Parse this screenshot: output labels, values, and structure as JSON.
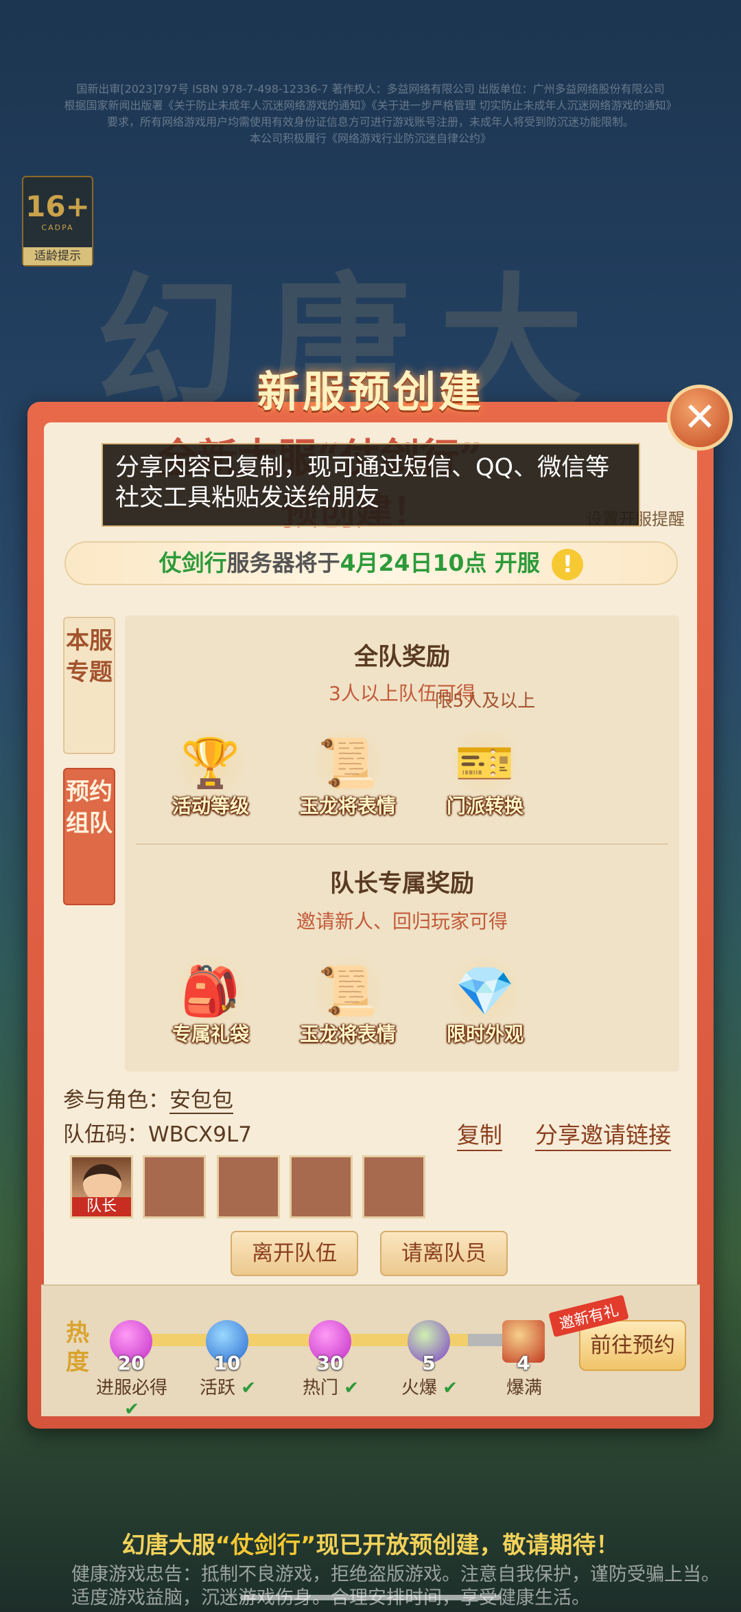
{
  "notice": {
    "line1": "国新出审[2023]797号 ISBN 978-7-498-12336-7 著作权人：多益网络有限公司 出版单位：广州多益网络股份有限公司",
    "line2": "根据国家新闻出版署《关于防止未成年人沉迷网络游戏的通知》《关于进一步严格管理 切实防止未成年人沉迷网络游戏的通知》",
    "line3": "要求，所有网络游戏用户均需使用有效身份证信息方可进行游戏账号注册，未成年人将受到防沉迷功能限制。",
    "line4": "本公司积极履行《网络游戏行业防沉迷自律公约》"
  },
  "age_badge": {
    "age": "16+",
    "org": "CADPA",
    "tip": "适龄提示"
  },
  "popup": {
    "title": "新服预创建",
    "ghost_heading1": "全新大服“仗剑行”",
    "ghost_heading2": "预创建！",
    "reminder": "设置开服提醒",
    "toast": "分享内容已复制，现可通过短信、QQ、微信等社交工具粘贴发送给朋友",
    "open_server_name": "仗剑行",
    "open_text_mid": "服务器将于",
    "open_time": "4月24日10点",
    "open_text_end": "开服",
    "tabs": [
      "本服专题",
      "预约组队"
    ],
    "team_rewards": {
      "title": "全队奖励",
      "subtitle": "3人以上队伍可得",
      "items": [
        {
          "label": "活动等级",
          "icon": "trophy-icon"
        },
        {
          "label": "玉龙将表情",
          "icon": "emote-scroll-icon"
        },
        {
          "label": "门派转换",
          "icon": "sect-ticket-icon",
          "limit": "限5人及以上"
        }
      ]
    },
    "leader_rewards": {
      "title": "队长专属奖励",
      "subtitle": "邀请新人、回归玩家可得",
      "items": [
        {
          "label": "专属礼袋",
          "icon": "gift-bag-icon"
        },
        {
          "label": "玉龙将表情",
          "icon": "emote-scroll-icon"
        },
        {
          "label": "限时外观",
          "icon": "crystal-icon"
        }
      ]
    },
    "role_label": "参与角色：",
    "role_name": "安包包",
    "team_code_label": "队伍码：",
    "team_code": "WBCX9L7",
    "copy": "复制",
    "share": "分享邀请链接",
    "leader_tag": "队长",
    "leave": "离开队伍",
    "kick": "请离队员",
    "heat": {
      "label": "热度",
      "nodes": [
        {
          "num": "20",
          "label": "进服必得",
          "done": "✔"
        },
        {
          "num": "10",
          "label": "活跃",
          "done": "✔"
        },
        {
          "num": "30",
          "label": "热门",
          "done": "✔"
        },
        {
          "num": "5",
          "label": "火爆",
          "done": "✔"
        },
        {
          "num": "4",
          "label": "爆满",
          "done": ""
        }
      ],
      "invite_tag": "邀新有礼",
      "pre_button": "前往预约"
    }
  },
  "bottom": {
    "banner_pre": "幻唐大服",
    "banner_name": "“仗剑行”",
    "banner_post": "现已开放预创建，敬请期待！",
    "health1": "健康游戏忠告：抵制不良游戏，拒绝盗版游戏。注意自我保护，谨防受骗上当。",
    "health2": "适度游戏益脑，沉迷游戏伤身。合理安排时间，享受健康生活。"
  },
  "colors": {
    "accent": "#d5553c",
    "green": "#2d9a3a",
    "gold": "#f6c933"
  }
}
